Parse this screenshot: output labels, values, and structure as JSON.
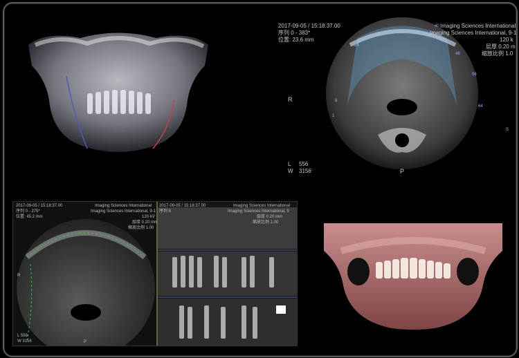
{
  "viewer": {
    "panel_3d_xray": {},
    "panel_axial": {
      "datetime": "2017-09-05 / 15:18:37.00",
      "sequence": "序列 0 - 383*",
      "position": "位置: 23.6 mm",
      "manufacturer_1": "Imaging Sciences International",
      "manufacturer_2": "Imaging Sciences International, 9-1",
      "kv": "120 k",
      "thickness": "层厚 0.20 m",
      "zoom": "缩放比例 1.0",
      "orient_right": "R",
      "orient_posterior": "P",
      "orient_side": "S",
      "window_l_label": "L",
      "window_l_value": "556",
      "window_w_label": "W",
      "window_w_value": "3156",
      "tick_40": "40",
      "tick_24": "24",
      "tick_8": "8",
      "tick_1": "1",
      "tick_64": "64",
      "tick_56": "56",
      "tick_48": "48"
    },
    "panel_multiview": {
      "datetime": "2017-09-05 / 15:18:37.00",
      "sequence": "序列 0 - 275*",
      "position": "位置: 45.2 mm",
      "manufacturer": "Imaging Sciences International",
      "manufacturer_2": "Imaging Sciences International, 9-1",
      "kv": "120 kV",
      "thickness": "层厚 0.20 mm",
      "zoom": "缩放比例 1.00",
      "orient_right": "R",
      "orient_posterior": "P",
      "window_l": "L 556",
      "window_w": "W 3156",
      "mid_datetime": "2017-09-05 / 15:18:37.00",
      "mid_sequence": "序列 8",
      "mid_manufacturer": "Imaging Sciences International",
      "mid_manufacturer_2": "Imaging Sciences International, 9",
      "mid_thickness": "层厚 0.20 mm",
      "mid_zoom": "缩放比例 1.00"
    },
    "panel_3d_render": {}
  }
}
